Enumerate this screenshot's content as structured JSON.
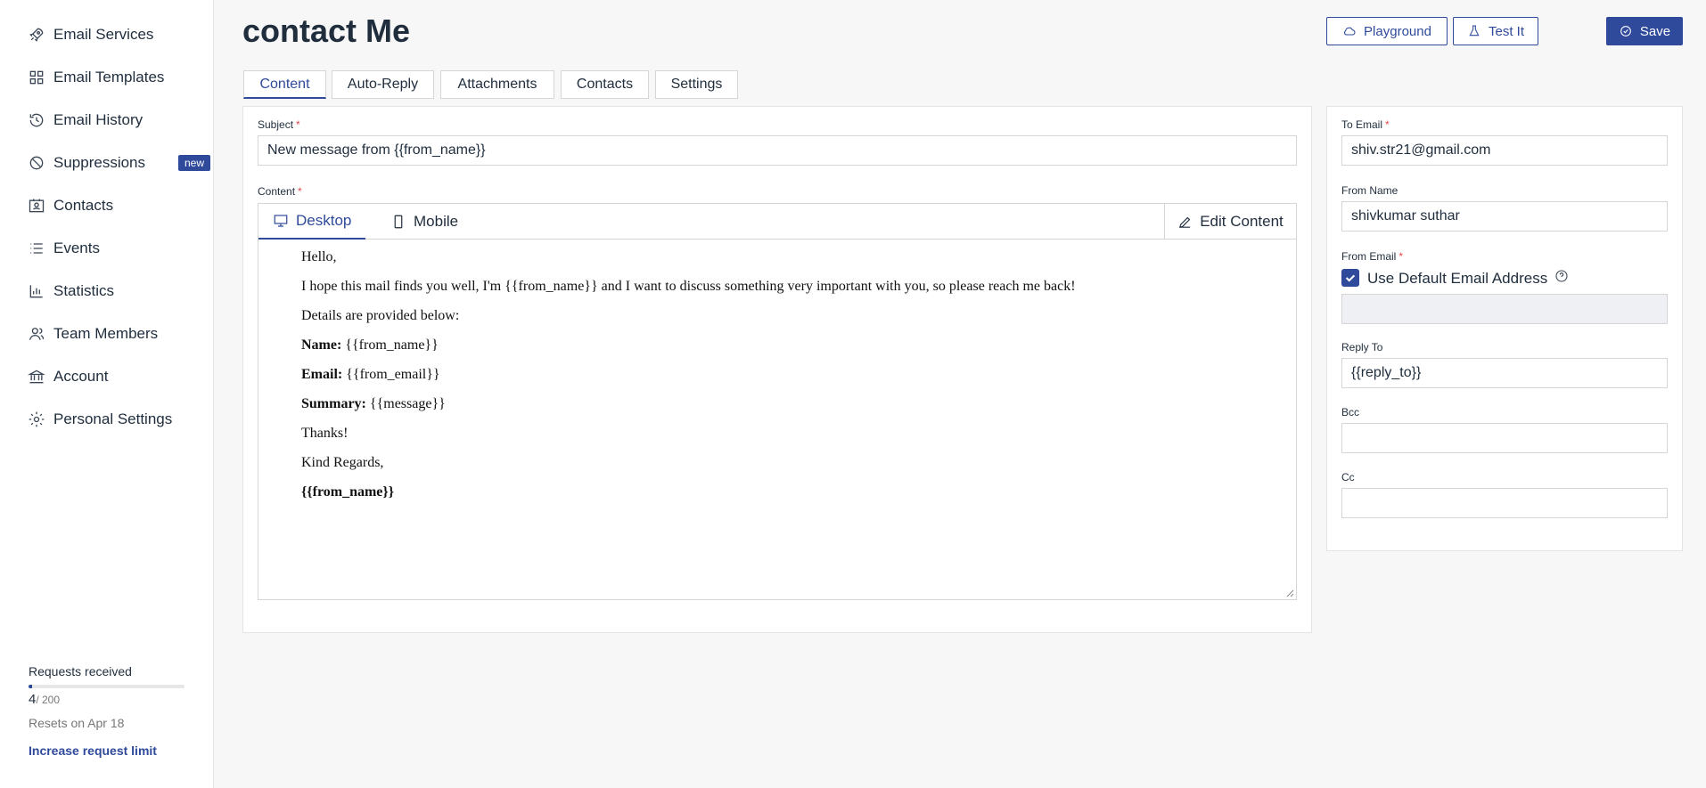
{
  "sidebar": {
    "items": [
      {
        "label": "Email Services",
        "icon": "rocket-icon"
      },
      {
        "label": "Email Templates",
        "icon": "grid-icon"
      },
      {
        "label": "Email History",
        "icon": "history-icon"
      },
      {
        "label": "Suppressions",
        "icon": "block-icon",
        "badge": "new"
      },
      {
        "label": "Contacts",
        "icon": "contact-card-icon"
      },
      {
        "label": "Events",
        "icon": "list-icon"
      },
      {
        "label": "Statistics",
        "icon": "bar-chart-icon"
      },
      {
        "label": "Team Members",
        "icon": "team-icon"
      },
      {
        "label": "Account",
        "icon": "bank-icon"
      },
      {
        "label": "Personal Settings",
        "icon": "gear-icon"
      }
    ],
    "usage": {
      "label": "Requests received",
      "count": "4",
      "max": "/ 200",
      "fraction": 0.02,
      "reset": "Resets on Apr 18",
      "link": "Increase request limit"
    }
  },
  "header": {
    "title": "contact Me",
    "playground_label": "Playground",
    "testit_label": "Test It",
    "save_label": "Save"
  },
  "tabs": [
    "Content",
    "Auto-Reply",
    "Attachments",
    "Contacts",
    "Settings"
  ],
  "content": {
    "subject_label": "Subject",
    "subject_value": "New message from {{from_name}}",
    "content_label": "Content",
    "desktop_label": "Desktop",
    "mobile_label": "Mobile",
    "edit_label": "Edit Content",
    "body": {
      "line1": "Hello,",
      "line2": "I hope this mail finds you well, I'm {{from_name}} and I want to discuss something very important with you, so please reach me back!",
      "line3": "Details are provided below:",
      "name_key": "Name:",
      "name_val": " {{from_name}}",
      "email_key": "Email:",
      "email_val": " {{from_email}}",
      "summary_key": "Summary:",
      "summary_val": " {{message}}",
      "thanks": "Thanks!",
      "regards": "Kind Regards,",
      "signature": "{{from_name}}"
    }
  },
  "side": {
    "to_label": "To Email",
    "to_value": "shiv.str21@gmail.com",
    "from_name_label": "From Name",
    "from_name_value": "shivkumar suthar",
    "from_email_label": "From Email",
    "default_email_label": "Use Default Email Address",
    "reply_label": "Reply To",
    "reply_value": "{{reply_to}}",
    "bcc_label": "Bcc",
    "cc_label": "Cc"
  },
  "colors": {
    "accent": "#2f4a9b",
    "required": "#e5484d"
  }
}
